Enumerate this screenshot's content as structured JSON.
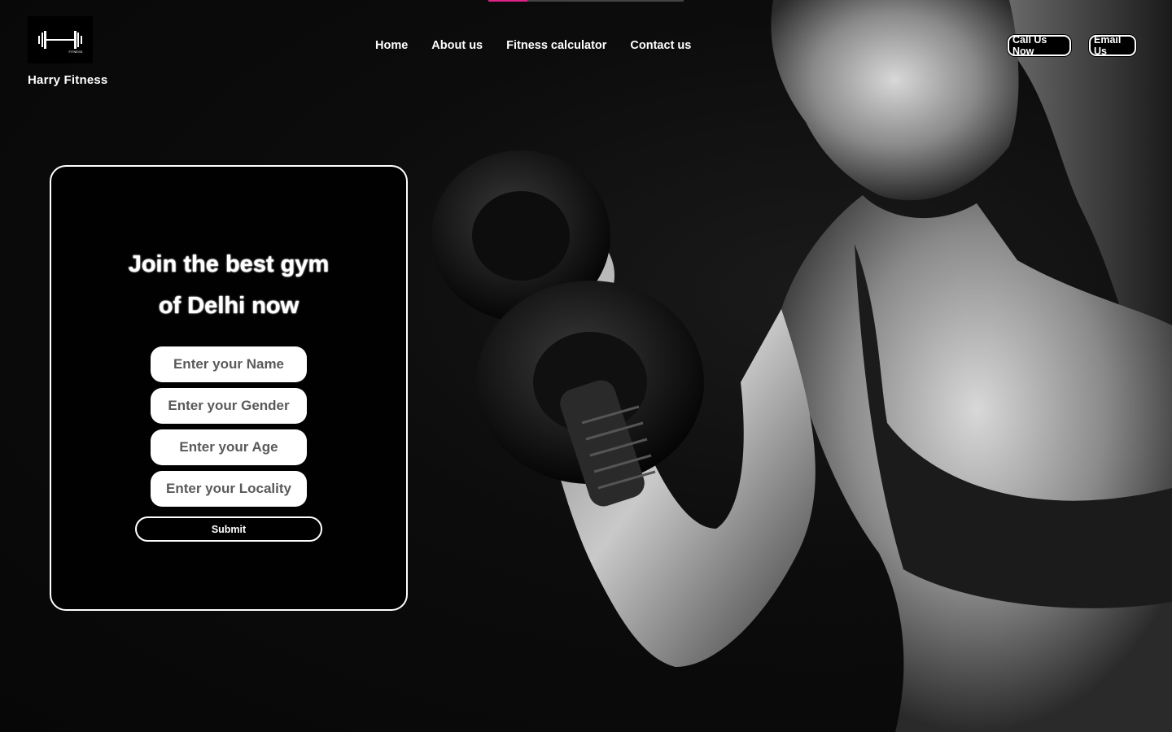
{
  "header": {
    "logo_icon": "barbell-logo-icon",
    "logo_caption": "FITNESS",
    "brand_name": "Harry Fitness",
    "nav": [
      {
        "label": "Home"
      },
      {
        "label": "About us"
      },
      {
        "label": "Fitness calculator"
      },
      {
        "label": "Contact us"
      }
    ],
    "call_button": "Call Us Now",
    "email_button": "Email Us"
  },
  "form": {
    "title_line1": "Join the best gym",
    "title_line2": "of Delhi now",
    "fields": [
      {
        "placeholder": "Enter your Name"
      },
      {
        "placeholder": "Enter your Gender"
      },
      {
        "placeholder": "Enter your Age"
      },
      {
        "placeholder": "Enter your Locality"
      }
    ],
    "submit_label": "Submit"
  },
  "colors": {
    "background": "#0b0b0b",
    "accent_pink": "#e0218a",
    "text": "#ffffff"
  }
}
